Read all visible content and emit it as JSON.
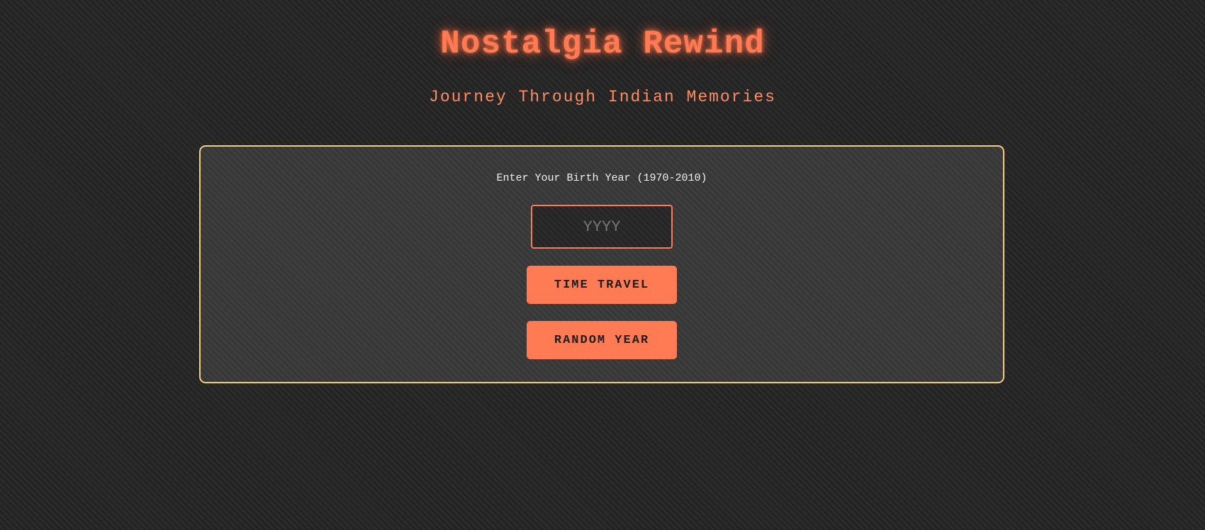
{
  "header": {
    "title": "Nostalgia Rewind",
    "subtitle": "Journey Through Indian Memories"
  },
  "form": {
    "label": "Enter Your Birth Year (1970-2010)",
    "year_input": {
      "value": "",
      "placeholder": "YYYY"
    },
    "time_travel_label": "TIME TRAVEL",
    "random_year_label": "RANDOM YEAR"
  },
  "colors": {
    "accent": "#ff7b53",
    "panel_border": "#f4cf7a",
    "background": "#252525"
  }
}
